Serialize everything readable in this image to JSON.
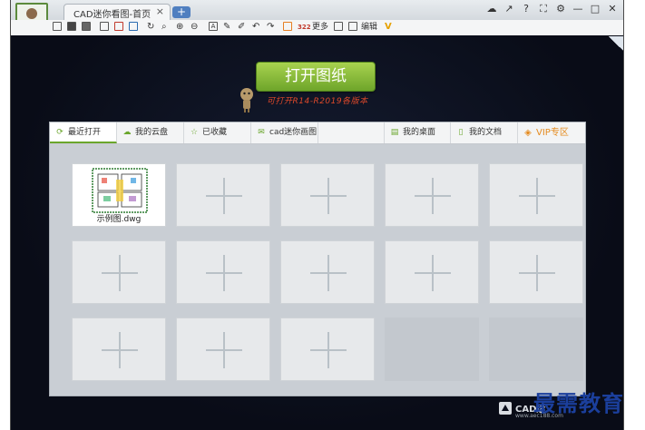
{
  "window": {
    "tab_title": "CAD迷你看图-首页",
    "tab_close": "×",
    "tab_add": "+"
  },
  "window_controls": [
    "☁",
    "↗",
    "?",
    "⛶",
    "⚙",
    "—",
    "□",
    "✕"
  ],
  "toolbar": {
    "more_label": "更多",
    "edit_label": "编辑",
    "count_label": "322"
  },
  "main": {
    "open_button": "打开图纸",
    "support_text": "可打开R14-R2019各版本"
  },
  "tabs": [
    {
      "label": "最近打开",
      "icon": "refresh-icon"
    },
    {
      "label": "我的云盘",
      "icon": "cloud-icon"
    },
    {
      "label": "已收藏",
      "icon": "star-icon"
    },
    {
      "label": "cad迷你画图",
      "icon": "mail-icon"
    },
    {
      "label": "我的桌面",
      "icon": "desktop-icon"
    },
    {
      "label": "我的文档",
      "icon": "document-icon"
    },
    {
      "label": "VIP专区",
      "icon": "vip-icon"
    }
  ],
  "files": [
    {
      "name": "示例图.dwg"
    }
  ],
  "logo": {
    "text": "CAD迷",
    "url": "www.aec188.com"
  },
  "watermark": "最需教育",
  "colors": {
    "accent": "#6aa62c",
    "vip": "#e58b1f",
    "background": "#0b0f1d",
    "support_text": "#e0492a",
    "watermark": "#1b3f9c"
  }
}
